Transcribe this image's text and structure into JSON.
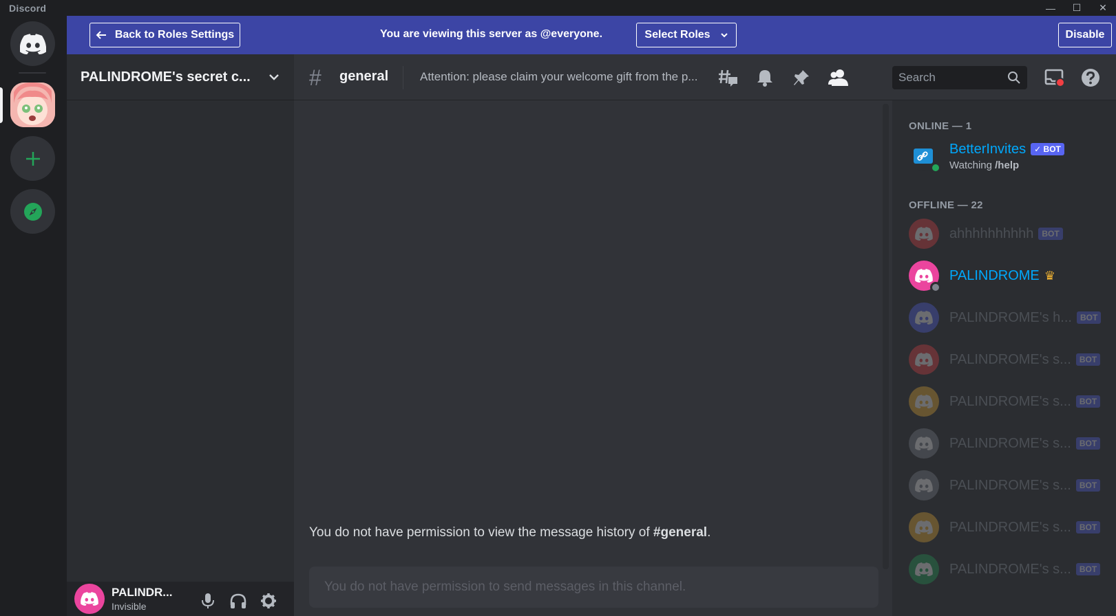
{
  "window": {
    "app_name": "Discord",
    "minimize": "—",
    "maximize": "☐",
    "close": "✕"
  },
  "banner": {
    "back_label": "Back to Roles Settings",
    "message": "You are viewing this server as @everyone.",
    "select_roles_label": "Select Roles",
    "disable_label": "Disable",
    "background": "#3c45a5"
  },
  "guild": {
    "name": "PALINDROME's secret c..."
  },
  "channel": {
    "name": "general",
    "topic": "Attention: please claim your welcome gift from the p...",
    "search_placeholder": "Search"
  },
  "chat": {
    "no_history_prefix": "You do not have permission to view the message history of ",
    "no_history_channel": "#general",
    "no_history_suffix": ".",
    "composer_placeholder": "You do not have permission to send messages in this channel."
  },
  "user_panel": {
    "name": "PALINDR...",
    "status": "Invisible"
  },
  "members": {
    "online_header": "ONLINE — 1",
    "offline_header": "OFFLINE — 22",
    "online": [
      {
        "name": "BetterInvites",
        "tag": "✓ BOT",
        "activity_prefix": "Watching ",
        "activity_bold": "/help",
        "color": "#00a8fc"
      }
    ],
    "offline": [
      {
        "name": "ahhhhhhhhhh",
        "tag": "BOT",
        "avatar_color": "#ed4245"
      },
      {
        "name": "PALINDROME",
        "tag": "",
        "avatar_color": "#eb459e",
        "crown": "♛",
        "name_color": "#00a8fc"
      },
      {
        "name": "PALINDROME's h...",
        "tag": "BOT",
        "avatar_color": "#5865f2"
      },
      {
        "name": "PALINDROME's s...",
        "tag": "BOT",
        "avatar_color": "#ed4245"
      },
      {
        "name": "PALINDROME's s...",
        "tag": "BOT",
        "avatar_color": "#f0b232"
      },
      {
        "name": "PALINDROME's s...",
        "tag": "BOT",
        "avatar_color": "#80848e"
      },
      {
        "name": "PALINDROME's s...",
        "tag": "BOT",
        "avatar_color": "#80848e"
      },
      {
        "name": "PALINDROME's s...",
        "tag": "BOT",
        "avatar_color": "#f0b232"
      },
      {
        "name": "PALINDROME's s...",
        "tag": "BOT",
        "avatar_color": "#23a559"
      }
    ]
  },
  "colors": {
    "brand": "#5865f2",
    "online": "#23a559",
    "crown": "#f0b232"
  }
}
